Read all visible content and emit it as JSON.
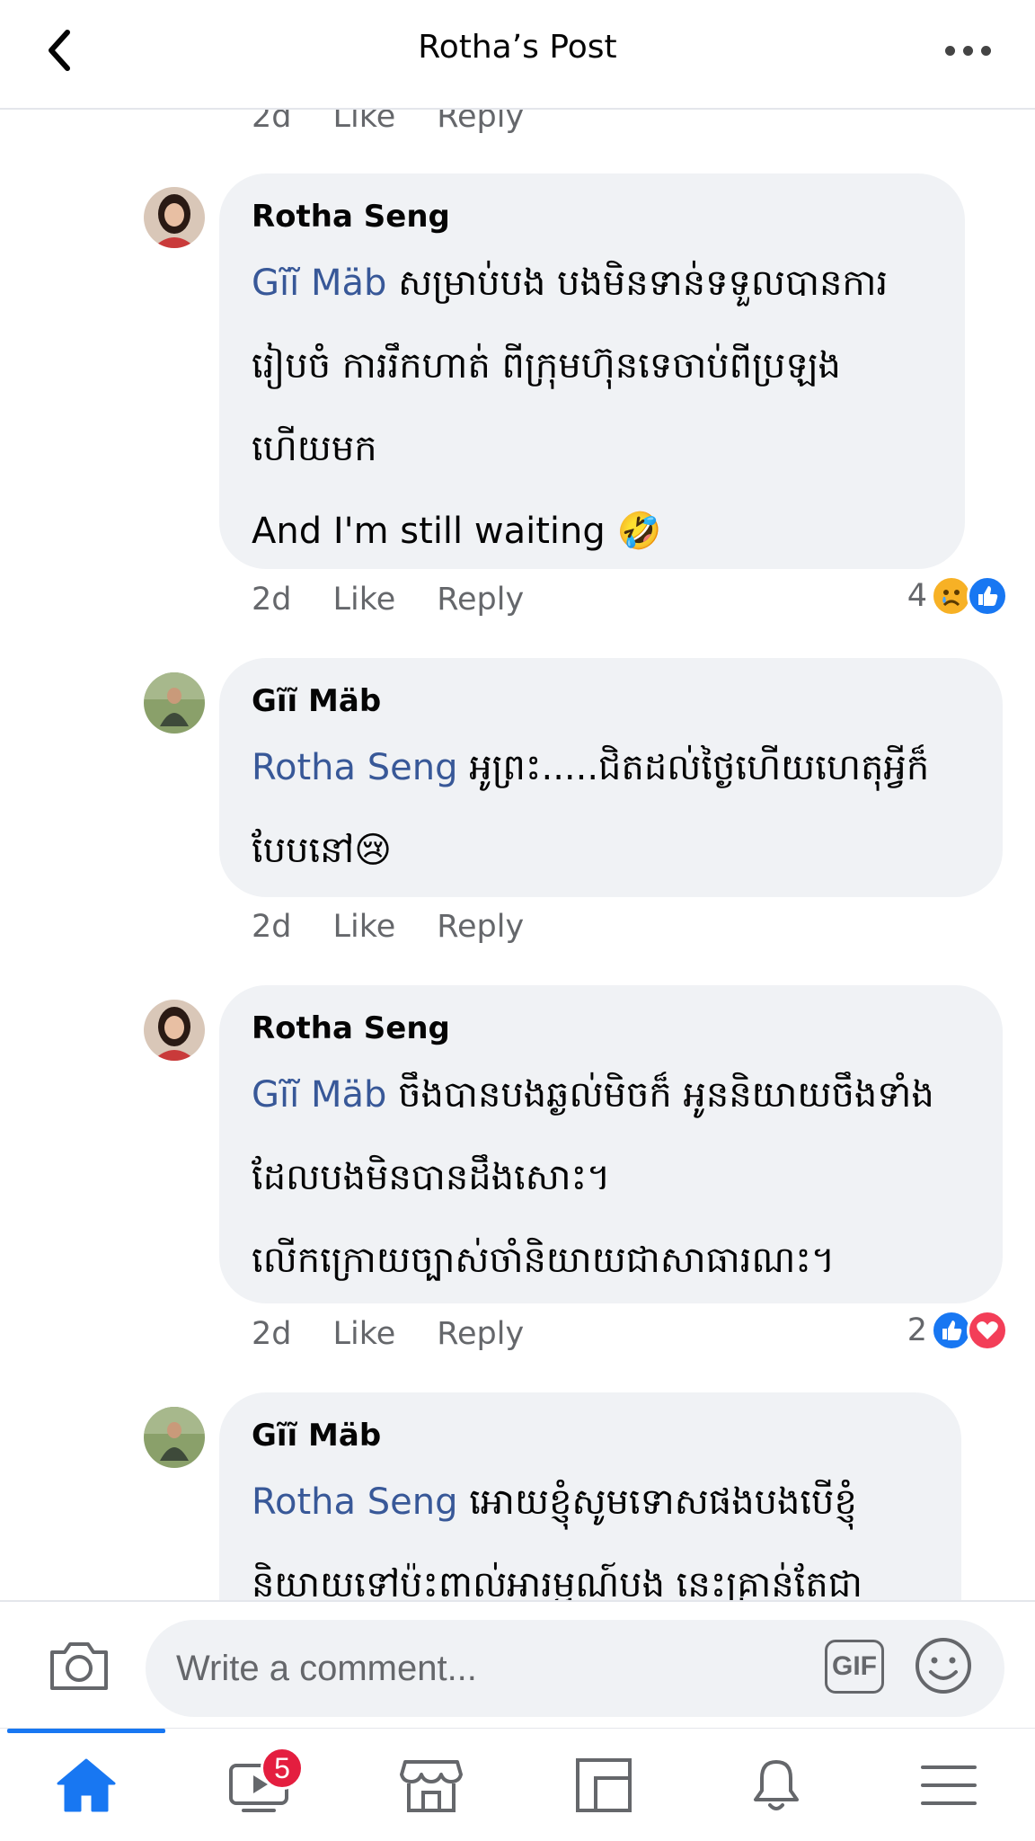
{
  "header": {
    "title": "Rotha’s Post"
  },
  "comments": [
    {
      "author": "",
      "meta": {
        "time": "2d",
        "like": "Like",
        "reply": "Reply"
      }
    },
    {
      "author": "Rotha Seng",
      "mention": "Gĩĩ Mäb",
      "lines": [
        " សម្រាប់បង បងមិនទាន់ទទួលបានការ",
        "រៀបចំ ការរឹកហាត់ ពីក្រុមហ៊ុនទេចាប់ពីប្រឡង",
        "ហើយមក",
        "And I'm still waiting 🤣"
      ],
      "meta": {
        "time": "2d",
        "like": "Like",
        "reply": "Reply"
      },
      "reactions": {
        "count": "4",
        "types": [
          "sad-icon",
          "like-icon"
        ]
      }
    },
    {
      "author": "Gĩĩ Mäb",
      "mention": "Rotha Seng",
      "lines": [
        " អូព្រះ.....ជិតដល់ថ្ងៃហើយហេតុអ្វីក៏",
        "បែបនៅ😢"
      ],
      "meta": {
        "time": "2d",
        "like": "Like",
        "reply": "Reply"
      }
    },
    {
      "author": "Rotha Seng",
      "mention": "Gĩĩ Mäb",
      "lines": [
        " ចឹងបានបងឆ្ងល់មិចក៏ អូននិយាយចឹងទាំង",
        "ដែលបងមិនបានដឹងសោះ។",
        "លើកក្រោយច្បាស់ចាំនិយាយជាសាធារណះ។"
      ],
      "meta": {
        "time": "2d",
        "like": "Like",
        "reply": "Reply"
      },
      "reactions": {
        "count": "2",
        "types": [
          "like-icon",
          "love-icon"
        ]
      }
    },
    {
      "author": "Gĩĩ Mäb",
      "mention": "Rotha Seng",
      "lines": [
        " អោយខ្ញុំសូមទោសផងបងបើខ្ញុំ",
        "និយាយទៅប៉ះពាល់អារម្មណ៍បង នេះគ្រាន់តែជា"
      ]
    }
  ],
  "composer": {
    "placeholder": "Write a comment...",
    "gif_label": "GIF"
  },
  "nav": {
    "items": [
      "home-icon",
      "watch-icon",
      "marketplace-icon",
      "pages-icon",
      "notifications-icon",
      "menu-icon"
    ],
    "watch_badge": "5",
    "active": "home"
  },
  "colors": {
    "accent": "#1877f2",
    "mention": "#385898",
    "bubble": "#f0f2f5",
    "meta": "#65676b",
    "badge": "#e41e3f"
  }
}
